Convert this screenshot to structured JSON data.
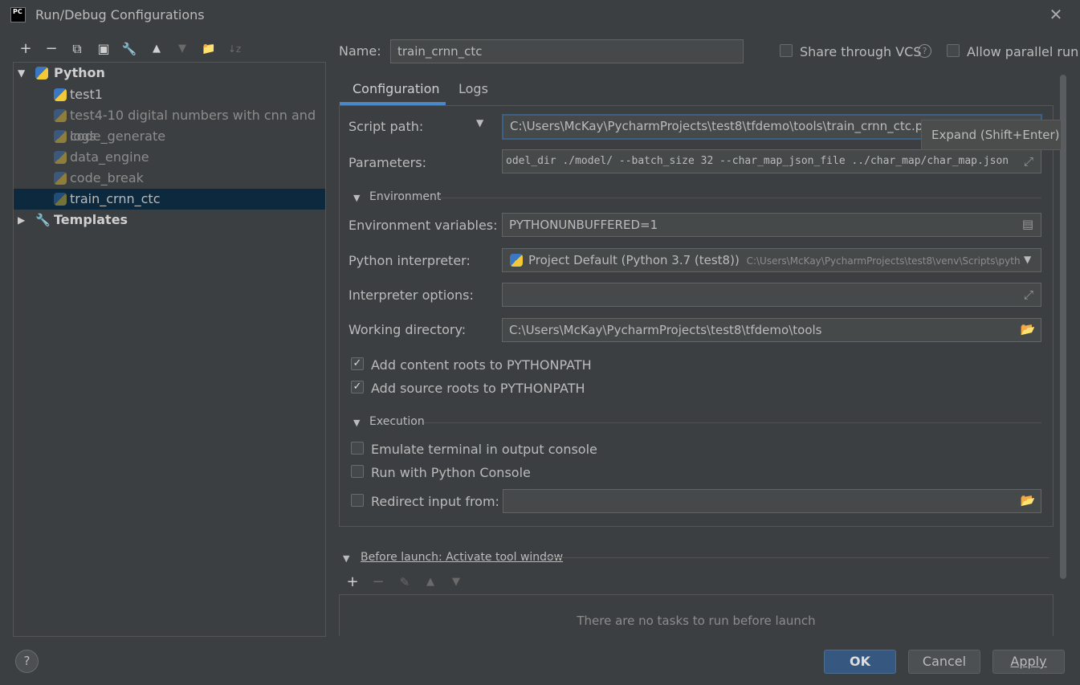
{
  "window": {
    "title": "Run/Debug Configurations",
    "app_icon_text": "PC"
  },
  "toolbar": {
    "add": "+",
    "remove": "−",
    "copy": "⧉",
    "save": "▣",
    "edit_defaults": "🔧",
    "move_up": "▲",
    "move_down": "▼",
    "folder": "📁",
    "sort": "↓z"
  },
  "tree": {
    "python_label": "Python",
    "items": [
      {
        "label": "test1"
      },
      {
        "label": "test4-10 digital numbers with cnn and logs"
      },
      {
        "label": "code_generate"
      },
      {
        "label": "data_engine"
      },
      {
        "label": "code_break"
      },
      {
        "label": "train_crnn_ctc"
      }
    ],
    "templates_label": "Templates"
  },
  "header": {
    "name_label": "Name:",
    "name_value": "train_crnn_ctc",
    "share_vcs_label": "Share through VCS",
    "allow_parallel_label": "Allow parallel run"
  },
  "tabs": [
    {
      "label": "Configuration"
    },
    {
      "label": "Logs"
    }
  ],
  "config": {
    "script_path_label": "Script path:",
    "script_path_value": "C:\\Users\\McKay\\PycharmProjects\\test8\\tfdemo\\tools\\train_crnn_ctc.py",
    "parameters_label": "Parameters:",
    "parameters_value": "odel_dir ./model/ --batch_size 32 --char_map_json_file ../char_map/char_map.json",
    "environment_section": "Environment",
    "env_vars_label": "Environment variables:",
    "env_vars_value": "PYTHONUNBUFFERED=1",
    "interpreter_label": "Python interpreter:",
    "interpreter_value": "Project Default (Python 3.7 (test8))",
    "interpreter_path": "C:\\Users\\McKay\\PycharmProjects\\test8\\venv\\Scripts\\pyth",
    "interp_options_label": "Interpreter options:",
    "interp_options_value": "",
    "working_dir_label": "Working directory:",
    "working_dir_value": "C:\\Users\\McKay\\PycharmProjects\\test8\\tfdemo\\tools",
    "content_roots_label": "Add content roots to PYTHONPATH",
    "source_roots_label": "Add source roots to PYTHONPATH",
    "execution_section": "Execution",
    "emulate_terminal_label": "Emulate terminal in output console",
    "python_console_label": "Run with Python Console",
    "redirect_input_label": "Redirect input from:",
    "redirect_input_value": ""
  },
  "before_launch": {
    "title": "Before launch: Activate tool window",
    "empty_text": "There are no tasks to run before launch"
  },
  "tooltip": {
    "text": "Expand (Shift+Enter)"
  },
  "buttons": {
    "ok": "OK",
    "cancel": "Cancel",
    "apply": "Apply",
    "help": "?"
  },
  "checks": {
    "mark": "✓"
  }
}
